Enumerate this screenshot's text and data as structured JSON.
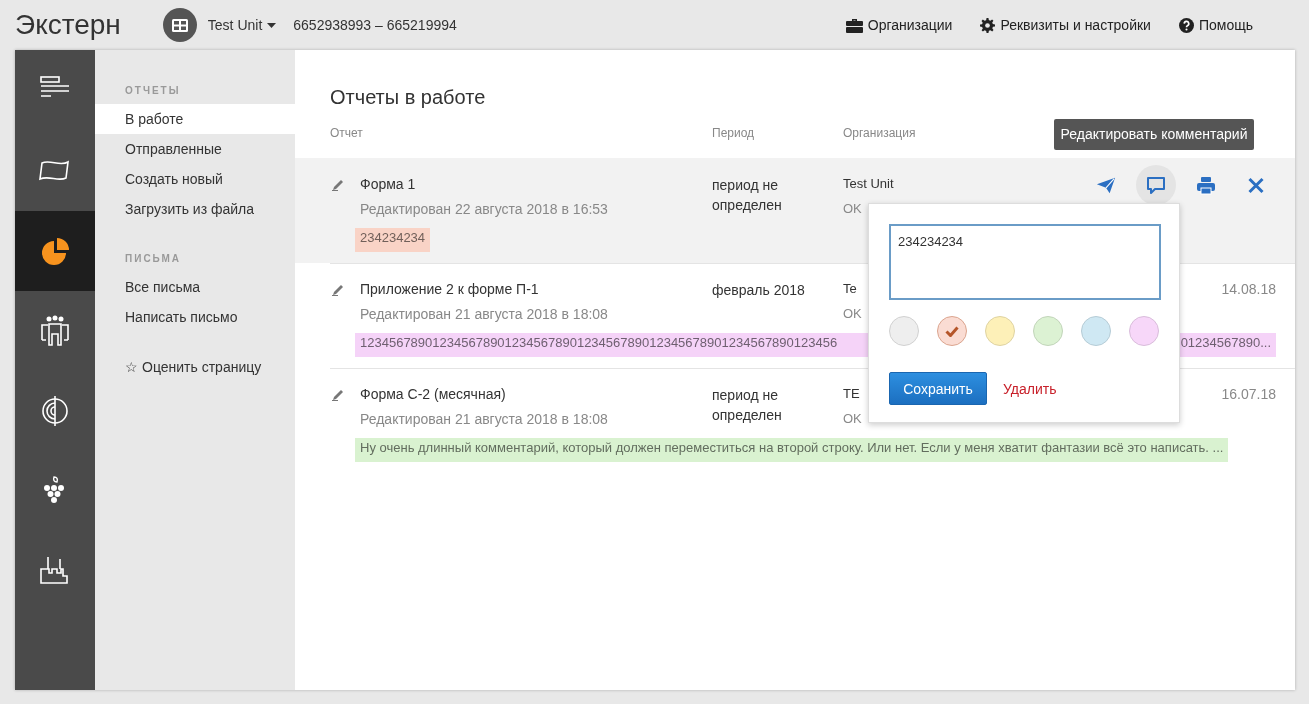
{
  "app": {
    "title": "Экстерн",
    "org_name": "Test Unit",
    "inn_kpp": "6652938993 – 665219994"
  },
  "top_links": [
    {
      "kind": "briefcase",
      "label": "Организации"
    },
    {
      "kind": "gear",
      "label": "Реквизиты и настройки"
    },
    {
      "kind": "help",
      "label": "Помощь"
    }
  ],
  "rail": [
    {
      "kind": "lines",
      "selected": false
    },
    {
      "kind": "flag",
      "selected": false
    },
    {
      "kind": "pie",
      "selected": true
    },
    {
      "kind": "people",
      "selected": false
    },
    {
      "kind": "target",
      "selected": false
    },
    {
      "kind": "grapes",
      "selected": false
    },
    {
      "kind": "factory",
      "selected": false
    }
  ],
  "nav": {
    "sections": [
      {
        "heading": "ОТЧЕТЫ",
        "items": [
          {
            "label": "В работе",
            "selected": true
          },
          {
            "label": "Отправленные",
            "selected": false
          },
          {
            "label": "Создать новый",
            "selected": false
          },
          {
            "label": "Загрузить из файла",
            "selected": false
          }
        ]
      },
      {
        "heading": "ПИСЬМА",
        "items": [
          {
            "label": "Все письма",
            "selected": false
          },
          {
            "label": "Написать письмо",
            "selected": false
          }
        ]
      }
    ],
    "rate_link": {
      "icon": "☆",
      "label": "Оценить страницу"
    }
  },
  "page": {
    "title": "Отчеты в работе",
    "columns": [
      "Отчет",
      "Период",
      "Организация"
    ],
    "rows": [
      {
        "name": "Форма 1",
        "edited": "Редактирован 22 августа 2018 в 16:53",
        "period": "период не определен",
        "org": "Test Unit",
        "org_code": "OK",
        "comment": "234234234",
        "color": "#f9d3c6",
        "hovered": true
      },
      {
        "name": "Приложение 2 к форме П-1",
        "edited": "Редактирован 21 августа 2018 в 18:08",
        "period": "февраль 2018",
        "org": "Te",
        "org_code": "OK",
        "created": "14.08.18",
        "comment": "123456789012345678901234567890123456789012345678901234567890123456",
        "comment_tail": "01234567890...",
        "color": "#f5d3f8",
        "hovered": false
      },
      {
        "name": "Форма С-2 (месячная)",
        "edited": "Редактирован 21 августа 2018 в 18:08",
        "period": "период не определен",
        "org": "TE",
        "org_code": "OK",
        "created": "16.07.18",
        "comment": "Ну очень длинный комментарий, который должен переместиться на второй строку. Или нет. Если у меня хватит фантазии всё это написать. ...",
        "color": "#d9f2d0",
        "hovered": false
      }
    ],
    "row_actions": [
      {
        "kind": "send",
        "active": false
      },
      {
        "kind": "comment",
        "active": true
      },
      {
        "kind": "print",
        "active": false
      },
      {
        "kind": "delete",
        "active": false
      }
    ],
    "tooltip": "Редактировать комментарий",
    "popover": {
      "value": "234234234",
      "colors": [
        {
          "color": "#eeeeee",
          "selected": false
        },
        {
          "color": "#fadcd3",
          "selected": true
        },
        {
          "color": "#fdf0b8",
          "selected": false
        },
        {
          "color": "#dcf2d3",
          "selected": false
        },
        {
          "color": "#cfe8f3",
          "selected": false
        },
        {
          "color": "#f7d7f9",
          "selected": false
        }
      ],
      "save": "Сохранить",
      "delete": "Удалить"
    }
  }
}
